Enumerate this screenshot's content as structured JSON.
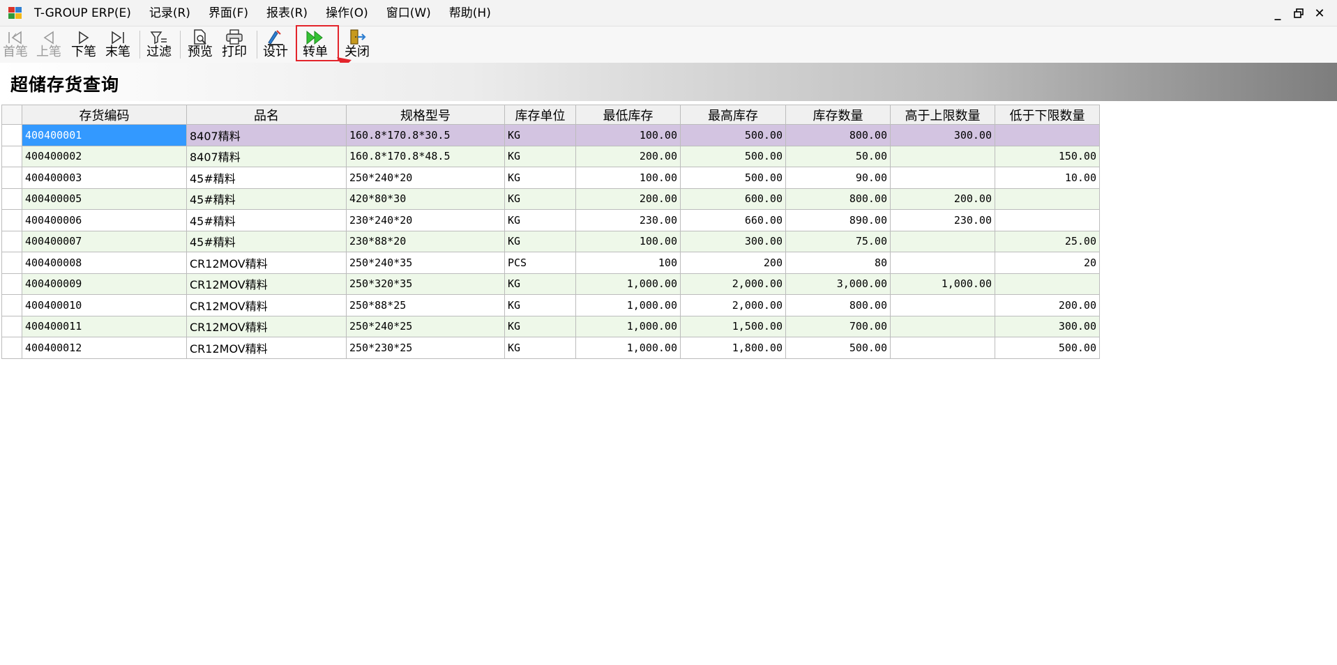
{
  "app": {
    "title": "T-GROUP ERP(E)",
    "menus": [
      "T-GROUP ERP(E)",
      "记录(R)",
      "界面(F)",
      "报表(R)",
      "操作(O)",
      "窗口(W)",
      "帮助(H)"
    ],
    "window_controls": {
      "minimize": "_",
      "restore": "🗗",
      "close": "✕"
    }
  },
  "toolbar": {
    "first": "首笔",
    "prev": "上笔",
    "next": "下笔",
    "last": "末笔",
    "filter": "过滤",
    "preview": "预览",
    "print": "打印",
    "design": "设计",
    "convert": "转单",
    "close": "关闭"
  },
  "colors": {
    "highlight": "#e3242b",
    "selected_row": "#d3c4e1",
    "active_cell": "#3399ff",
    "alt_row": "#eef8e9"
  },
  "page": {
    "title": "超储存货查询"
  },
  "grid": {
    "columns": [
      "存货编码",
      "品名",
      "规格型号",
      "库存单位",
      "最低库存",
      "最高库存",
      "库存数量",
      "高于上限数量",
      "低于下限数量"
    ],
    "rows": [
      [
        "400400001",
        "8407精料",
        "160.8*170.8*30.5",
        "KG",
        "100.00",
        "500.00",
        "800.00",
        "300.00",
        ""
      ],
      [
        "400400002",
        "8407精料",
        "160.8*170.8*48.5",
        "KG",
        "200.00",
        "500.00",
        "50.00",
        "",
        "150.00"
      ],
      [
        "400400003",
        "45#精料",
        "250*240*20",
        "KG",
        "100.00",
        "500.00",
        "90.00",
        "",
        "10.00"
      ],
      [
        "400400005",
        "45#精料",
        "420*80*30",
        "KG",
        "200.00",
        "600.00",
        "800.00",
        "200.00",
        ""
      ],
      [
        "400400006",
        "45#精料",
        "230*240*20",
        "KG",
        "230.00",
        "660.00",
        "890.00",
        "230.00",
        ""
      ],
      [
        "400400007",
        "45#精料",
        "230*88*20",
        "KG",
        "100.00",
        "300.00",
        "75.00",
        "",
        "25.00"
      ],
      [
        "400400008",
        "CR12MOV精料",
        "250*240*35",
        "PCS",
        "100",
        "200",
        "80",
        "",
        "20"
      ],
      [
        "400400009",
        "CR12MOV精料",
        "250*320*35",
        "KG",
        "1,000.00",
        "2,000.00",
        "3,000.00",
        "1,000.00",
        ""
      ],
      [
        "400400010",
        "CR12MOV精料",
        "250*88*25",
        "KG",
        "1,000.00",
        "2,000.00",
        "800.00",
        "",
        "200.00"
      ],
      [
        "400400011",
        "CR12MOV精料",
        "250*240*25",
        "KG",
        "1,000.00",
        "1,500.00",
        "700.00",
        "",
        "300.00"
      ],
      [
        "400400012",
        "CR12MOV精料",
        "250*230*25",
        "KG",
        "1,000.00",
        "1,800.00",
        "500.00",
        "",
        "500.00"
      ]
    ]
  }
}
